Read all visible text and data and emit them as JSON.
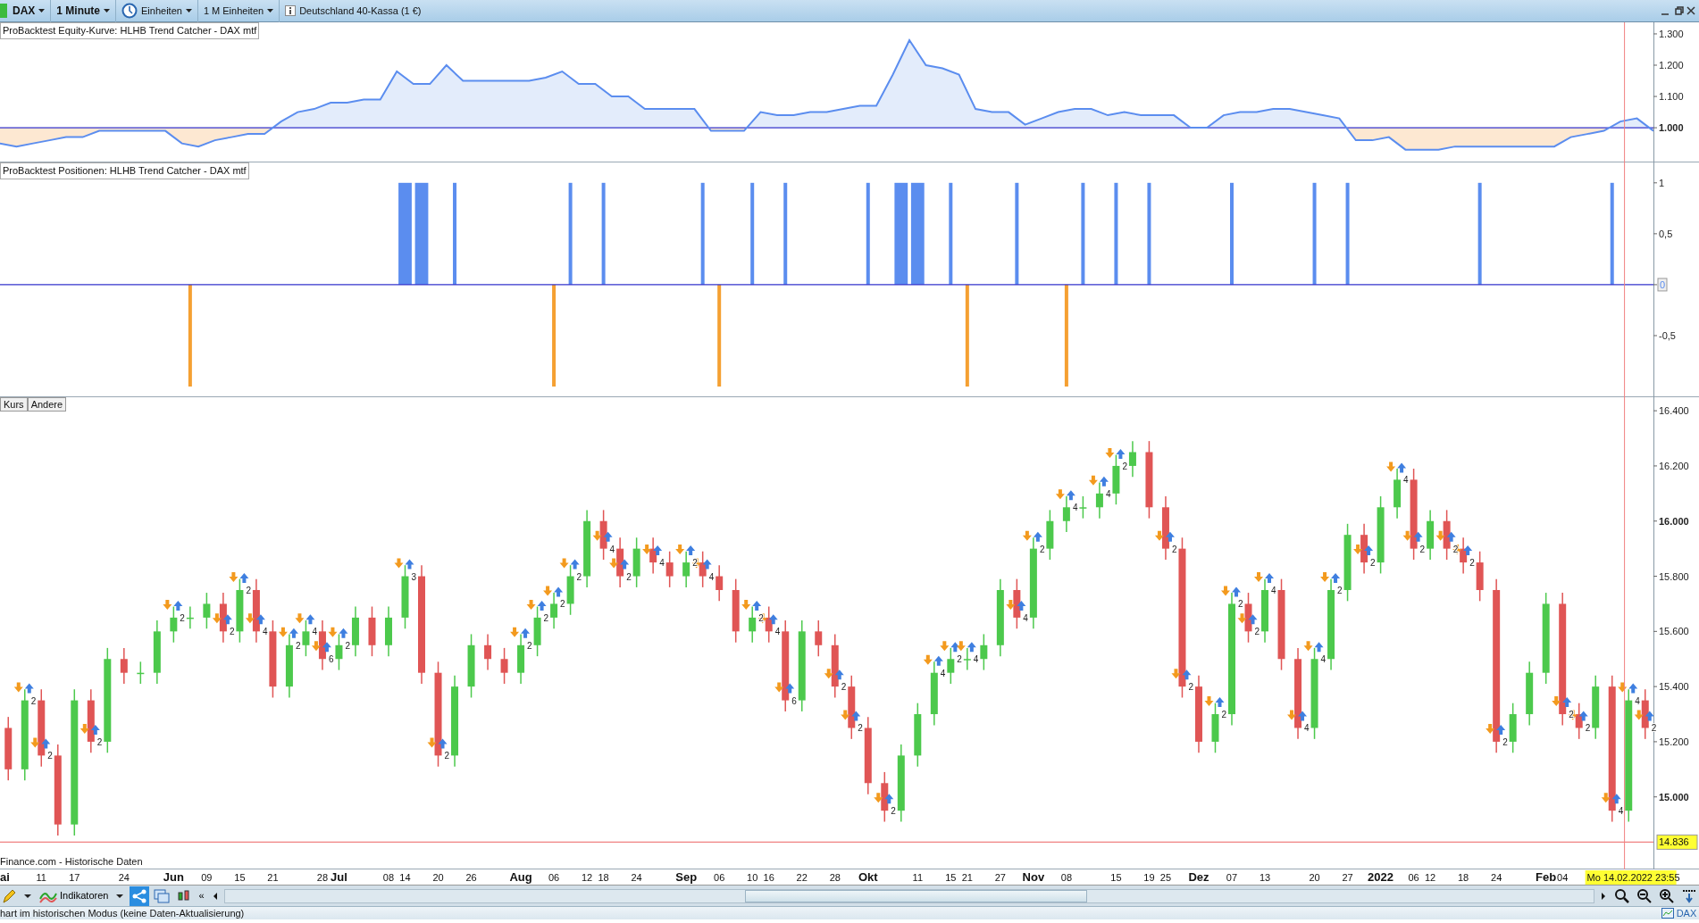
{
  "toolbar": {
    "items": [
      {
        "kind": "instrument",
        "label": "DAX"
      },
      {
        "kind": "timeframe",
        "label": "1 Minute"
      },
      {
        "kind": "units",
        "label": "Einheiten"
      },
      {
        "kind": "plain",
        "label": "1 M Einheiten"
      },
      {
        "kind": "info",
        "label": "Deutschland 40-Kassa (1 €)"
      }
    ]
  },
  "equity_panel": {
    "chart_data": {
      "type": "line",
      "title": "ProBacktest Equity-Kurve: HLHB Trend Catcher - DAX mtf",
      "ylim": [
        889,
        1337
      ],
      "yticks": [
        {
          "value": 1000,
          "label": "1.000"
        },
        {
          "value": 1100,
          "label": "1.100"
        },
        {
          "value": 1200,
          "label": "1.200"
        },
        {
          "value": 1300,
          "label": "1.300"
        }
      ],
      "ref_lines": [
        {
          "axis": "y",
          "value": 1000,
          "color": "#3333cc"
        }
      ],
      "series": [
        {
          "color": "#5b8def",
          "values": [
            950,
            940,
            950,
            960,
            970,
            970,
            990,
            990,
            990,
            990,
            990,
            950,
            940,
            960,
            970,
            980,
            980,
            1020,
            1050,
            1060,
            1080,
            1080,
            1090,
            1090,
            1180,
            1140,
            1140,
            1200,
            1150,
            1150,
            1150,
            1150,
            1150,
            1160,
            1180,
            1140,
            1140,
            1100,
            1100,
            1060,
            1060,
            1060,
            1060,
            990,
            990,
            990,
            1050,
            1040,
            1040,
            1050,
            1050,
            1060,
            1070,
            1070,
            1170,
            1280,
            1200,
            1190,
            1170,
            1060,
            1050,
            1050,
            1010,
            1030,
            1050,
            1060,
            1060,
            1040,
            1050,
            1040,
            1040,
            1040,
            1000,
            1000,
            1040,
            1050,
            1050,
            1060,
            1060,
            1050,
            1040,
            1030,
            960,
            960,
            970,
            930,
            930,
            930,
            940,
            940,
            940,
            940,
            940,
            940,
            940,
            970,
            980,
            990,
            1020,
            1030,
            990
          ]
        }
      ]
    }
  },
  "positions_panel": {
    "chart_data": {
      "type": "bar",
      "title": "ProBacktest Positionen: HLHB Trend Catcher - DAX mtf",
      "ylim": [
        -1.105,
        1.2
      ],
      "yticks": [
        {
          "value": 1,
          "label": "1"
        },
        {
          "value": 0.5,
          "label": "0,5"
        },
        {
          "value": 0,
          "label": "0"
        },
        {
          "value": -0.5,
          "label": "-0,5"
        }
      ],
      "ref_lines": [
        {
          "axis": "y",
          "value": 0,
          "color": "#3333cc"
        }
      ],
      "series": [
        {
          "color": "#5b8def",
          "values": [
            null,
            null,
            null,
            null,
            null,
            null,
            null,
            null,
            null,
            null,
            null,
            null,
            null,
            null,
            null,
            null,
            null,
            null,
            null,
            null,
            null,
            null,
            null,
            null,
            1,
            1,
            null,
            1,
            null,
            null,
            null,
            null,
            null,
            null,
            1,
            null,
            1,
            null,
            null,
            null,
            null,
            null,
            1,
            null,
            null,
            1,
            null,
            1,
            null,
            null,
            null,
            null,
            1,
            null,
            1,
            1,
            null,
            1,
            null,
            null,
            null,
            1,
            null,
            null,
            null,
            1,
            null,
            1,
            null,
            1,
            null,
            null,
            null,
            null,
            1,
            null,
            null,
            null,
            null,
            1,
            null,
            1,
            null,
            null,
            null,
            null,
            null,
            null,
            null,
            1,
            null,
            null,
            null,
            null,
            null,
            null,
            null,
            1,
            null,
            null
          ]
        },
        {
          "color": "#f5a032",
          "values": [
            null,
            null,
            null,
            null,
            null,
            null,
            null,
            null,
            null,
            null,
            null,
            -1,
            null,
            null,
            null,
            null,
            null,
            null,
            null,
            null,
            null,
            null,
            null,
            null,
            null,
            null,
            null,
            null,
            null,
            null,
            null,
            null,
            null,
            -1,
            null,
            null,
            null,
            null,
            null,
            null,
            null,
            null,
            null,
            -1,
            null,
            null,
            null,
            null,
            null,
            null,
            null,
            null,
            null,
            null,
            null,
            null,
            null,
            null,
            -1,
            null,
            null,
            null,
            null,
            null,
            -1,
            null,
            null,
            null,
            null,
            null,
            null,
            null,
            null,
            null,
            null,
            null,
            null,
            null,
            null,
            null,
            null,
            null,
            null,
            null,
            null,
            null,
            null,
            null,
            null,
            null,
            null,
            null,
            null,
            null,
            null,
            null,
            null,
            null,
            null,
            null
          ]
        }
      ]
    }
  },
  "price_panel": {
    "tabs": [
      "Kurs",
      "Andere"
    ],
    "source": "Finance.com - Historische Daten",
    "last_price": "14.836",
    "cursor_label": "Mo 14.02.2022 23:55",
    "trade_markers": [
      {
        "text": "2"
      },
      {
        "text": "2"
      },
      {
        "text": "2"
      },
      {
        "text": "2"
      },
      {
        "text": "2"
      },
      {
        "text": "2"
      },
      {
        "text": "4"
      },
      {
        "text": "2"
      },
      {
        "text": "4"
      },
      {
        "text": "6"
      },
      {
        "text": "2"
      },
      {
        "text": "3"
      },
      {
        "text": "2"
      },
      {
        "text": "2"
      },
      {
        "text": "2"
      },
      {
        "text": "2"
      },
      {
        "text": "2"
      },
      {
        "text": "4"
      },
      {
        "text": "2"
      },
      {
        "text": "4"
      },
      {
        "text": "2"
      },
      {
        "text": "4"
      },
      {
        "text": "2"
      },
      {
        "text": "4"
      },
      {
        "text": "6"
      },
      {
        "text": "2"
      },
      {
        "text": "2"
      },
      {
        "text": "2"
      },
      {
        "text": "4"
      },
      {
        "text": "2"
      },
      {
        "text": "4"
      },
      {
        "text": "4"
      },
      {
        "text": "2"
      },
      {
        "text": "4"
      },
      {
        "text": "4"
      },
      {
        "text": "2"
      },
      {
        "text": "2"
      },
      {
        "text": "2"
      },
      {
        "text": "2"
      },
      {
        "text": "2"
      },
      {
        "text": "2"
      },
      {
        "text": "4"
      },
      {
        "text": "4"
      },
      {
        "text": "4"
      },
      {
        "text": "2"
      },
      {
        "text": "2"
      },
      {
        "text": "4"
      },
      {
        "text": "2"
      },
      {
        "text": "2"
      },
      {
        "text": "2"
      },
      {
        "text": "2"
      },
      {
        "text": "2"
      },
      {
        "text": "2"
      },
      {
        "text": "4"
      },
      {
        "text": "4"
      },
      {
        "text": "2"
      }
    ],
    "chart_data": {
      "type": "candlestick",
      "ylim": [
        14737,
        16449
      ],
      "ref_lines": [
        {
          "axis": "y",
          "value": 14836,
          "color": "#f08080"
        }
      ],
      "categories": [
        "ai",
        null,
        "11",
        null,
        "17",
        null,
        null,
        "24",
        null,
        null,
        "Jun",
        null,
        "09",
        null,
        "15",
        null,
        "21",
        null,
        null,
        "28",
        "Jul",
        null,
        null,
        "08",
        "14",
        null,
        "20",
        null,
        "26",
        null,
        null,
        "Aug",
        null,
        "06",
        null,
        "12",
        "18",
        null,
        "24",
        null,
        null,
        "Sep",
        null,
        "06",
        null,
        "10",
        "16",
        null,
        "22",
        null,
        "28",
        null,
        "Okt",
        null,
        null,
        "11",
        null,
        "15",
        "21",
        null,
        "27",
        null,
        "Nov",
        null,
        "08",
        null,
        null,
        "15",
        null,
        "19",
        "25",
        null,
        "Dez",
        null,
        "07",
        null,
        "13",
        null,
        null,
        "20",
        null,
        "27",
        null,
        "2022",
        null,
        "06",
        "12",
        null,
        "18",
        null,
        "24",
        null,
        null,
        "Feb",
        "04",
        null,
        null,
        null,
        null,
        null
      ],
      "ohlc": [
        [
          15250,
          15290,
          15060,
          15100
        ],
        [
          15100,
          15390,
          15060,
          15350
        ],
        [
          15350,
          15390,
          15110,
          15150
        ],
        [
          15150,
          15190,
          14860,
          14900
        ],
        [
          14900,
          15390,
          14860,
          15350
        ],
        [
          15350,
          15390,
          15160,
          15200
        ],
        [
          15200,
          15540,
          15160,
          15500
        ],
        [
          15500,
          15540,
          15410,
          15450
        ],
        [
          15450,
          15490,
          15410,
          15450
        ],
        [
          15450,
          15640,
          15410,
          15600
        ],
        [
          15600,
          15690,
          15560,
          15650
        ],
        [
          15650,
          15690,
          15610,
          15650
        ],
        [
          15650,
          15740,
          15610,
          15700
        ],
        [
          15700,
          15740,
          15560,
          15600
        ],
        [
          15600,
          15790,
          15560,
          15750
        ],
        [
          15750,
          15790,
          15560,
          15600
        ],
        [
          15600,
          15640,
          15360,
          15400
        ],
        [
          15400,
          15590,
          15360,
          15550
        ],
        [
          15550,
          15640,
          15510,
          15600
        ],
        [
          15600,
          15640,
          15460,
          15500
        ],
        [
          15500,
          15590,
          15460,
          15550
        ],
        [
          15550,
          15690,
          15510,
          15650
        ],
        [
          15650,
          15690,
          15510,
          15550
        ],
        [
          15550,
          15690,
          15510,
          15650
        ],
        [
          15650,
          15840,
          15610,
          15800
        ],
        [
          15800,
          15840,
          15410,
          15450
        ],
        [
          15450,
          15490,
          15110,
          15150
        ],
        [
          15150,
          15440,
          15110,
          15400
        ],
        [
          15400,
          15590,
          15360,
          15550
        ],
        [
          15550,
          15590,
          15460,
          15500
        ],
        [
          15500,
          15540,
          15410,
          15450
        ],
        [
          15450,
          15590,
          15410,
          15550
        ],
        [
          15550,
          15690,
          15510,
          15650
        ],
        [
          15650,
          15740,
          15610,
          15700
        ],
        [
          15700,
          15840,
          15660,
          15800
        ],
        [
          15800,
          16040,
          15760,
          16000
        ],
        [
          16000,
          16040,
          15860,
          15900
        ],
        [
          15900,
          15940,
          15760,
          15800
        ],
        [
          15800,
          15940,
          15760,
          15900
        ],
        [
          15900,
          15940,
          15810,
          15850
        ],
        [
          15850,
          15890,
          15760,
          15800
        ],
        [
          15800,
          15890,
          15760,
          15850
        ],
        [
          15850,
          15890,
          15760,
          15800
        ],
        [
          15800,
          15840,
          15710,
          15750
        ],
        [
          15750,
          15790,
          15560,
          15600
        ],
        [
          15600,
          15690,
          15560,
          15650
        ],
        [
          15650,
          15690,
          15560,
          15600
        ],
        [
          15600,
          15640,
          15310,
          15350
        ],
        [
          15350,
          15640,
          15310,
          15600
        ],
        [
          15600,
          15640,
          15510,
          15550
        ],
        [
          15550,
          15590,
          15360,
          15400
        ],
        [
          15400,
          15440,
          15210,
          15250
        ],
        [
          15250,
          15290,
          15010,
          15050
        ],
        [
          15050,
          15090,
          14910,
          14950
        ],
        [
          14950,
          15190,
          14910,
          15150
        ],
        [
          15150,
          15340,
          15110,
          15300
        ],
        [
          15300,
          15490,
          15260,
          15450
        ],
        [
          15450,
          15540,
          15410,
          15500
        ],
        [
          15500,
          15540,
          15460,
          15500
        ],
        [
          15500,
          15590,
          15460,
          15550
        ],
        [
          15550,
          15790,
          15510,
          15750
        ],
        [
          15750,
          15790,
          15610,
          15650
        ],
        [
          15650,
          15940,
          15610,
          15900
        ],
        [
          15900,
          16040,
          15860,
          16000
        ],
        [
          16000,
          16090,
          15960,
          16050
        ],
        [
          16050,
          16090,
          16010,
          16050
        ],
        [
          16050,
          16140,
          16010,
          16100
        ],
        [
          16100,
          16240,
          16060,
          16200
        ],
        [
          16200,
          16290,
          16160,
          16250
        ],
        [
          16250,
          16290,
          16010,
          16050
        ],
        [
          16050,
          16090,
          15860,
          15900
        ],
        [
          15900,
          15940,
          15360,
          15400
        ],
        [
          15400,
          15440,
          15160,
          15200
        ],
        [
          15200,
          15340,
          15160,
          15300
        ],
        [
          15300,
          15740,
          15260,
          15700
        ],
        [
          15700,
          15740,
          15560,
          15600
        ],
        [
          15600,
          15790,
          15560,
          15750
        ],
        [
          15750,
          15790,
          15460,
          15500
        ],
        [
          15500,
          15540,
          15210,
          15250
        ],
        [
          15250,
          15540,
          15210,
          15500
        ],
        [
          15500,
          15790,
          15460,
          15750
        ],
        [
          15750,
          15990,
          15710,
          15950
        ],
        [
          15950,
          15990,
          15810,
          15850
        ],
        [
          15850,
          16090,
          15810,
          16050
        ],
        [
          16050,
          16190,
          16010,
          16150
        ],
        [
          16150,
          16190,
          15860,
          15900
        ],
        [
          15900,
          16040,
          15860,
          16000
        ],
        [
          16000,
          16040,
          15860,
          15900
        ],
        [
          15900,
          15940,
          15810,
          15850
        ],
        [
          15850,
          15890,
          15710,
          15750
        ],
        [
          15750,
          15790,
          15160,
          15200
        ],
        [
          15200,
          15340,
          15160,
          15300
        ],
        [
          15300,
          15490,
          15260,
          15450
        ],
        [
          15450,
          15740,
          15410,
          15700
        ],
        [
          15700,
          15740,
          15260,
          15300
        ],
        [
          15300,
          15340,
          15210,
          15250
        ],
        [
          15250,
          15440,
          15210,
          15400
        ],
        [
          15400,
          15440,
          14910,
          14950
        ],
        [
          14950,
          15390,
          14910,
          15350
        ],
        [
          15350,
          15390,
          15210,
          15250
        ]
      ],
      "yticks": [
        {
          "value": 16400,
          "label": "16.400"
        },
        {
          "value": 16200,
          "label": "16.200"
        },
        {
          "value": 16000,
          "label": "16.000"
        },
        {
          "value": 15800,
          "label": "15.800"
        },
        {
          "value": 15600,
          "label": "15.600"
        },
        {
          "value": 15400,
          "label": "15.400"
        },
        {
          "value": 15200,
          "label": "15.200"
        },
        {
          "value": 15000,
          "label": "15.000"
        }
      ]
    }
  },
  "bottom_toolbar": {
    "indicators_label": "Indikatoren",
    "scroll_back": "«"
  },
  "status_bar": {
    "message": "hart im historischen Modus (keine Daten-Aktualisierung)",
    "instrument": "DAX"
  }
}
